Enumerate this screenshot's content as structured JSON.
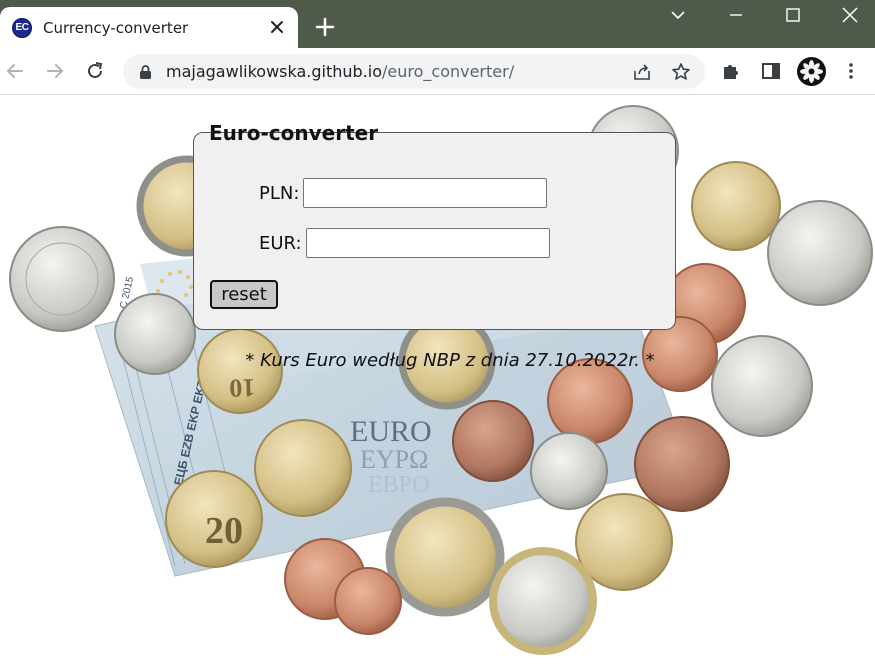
{
  "browser": {
    "tab": {
      "favicon_text": "EC",
      "title": "Currency-converter"
    },
    "url": {
      "host": "majagawlikowska.github.io",
      "path": "/euro_converter/"
    }
  },
  "converter": {
    "legend": "Euro-converter",
    "pln": {
      "label": "PLN:",
      "value": ""
    },
    "eur": {
      "label": "EUR:",
      "value": ""
    },
    "reset_label": "reset"
  },
  "note": "* Kurs Euro według NBP z dnia 27.10.2022r. *",
  "background": {
    "banknote_text": [
      "EURO",
      "ΕΥΡΩ",
      "ЕВРО"
    ],
    "banknote_side_text": "ЕЦБ EZB EKP EKT",
    "banknote_value": "20",
    "coin_value": "20",
    "year": "C 2015"
  }
}
